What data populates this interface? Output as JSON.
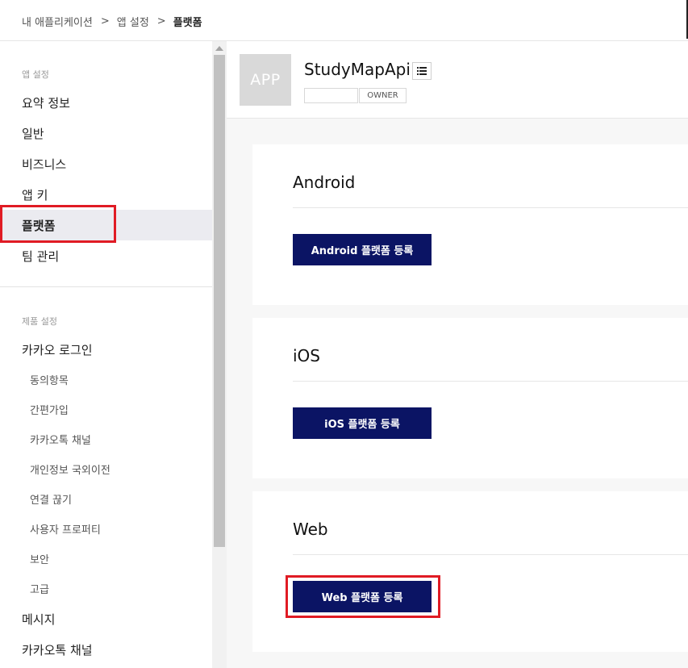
{
  "breadcrumb": {
    "items": [
      "내 애플리케이션",
      "앱 설정",
      "플랫폼"
    ],
    "separator": ">"
  },
  "sidebar": {
    "app_section_title": "앱 설정",
    "app_items": [
      {
        "label": "요약 정보"
      },
      {
        "label": "일반"
      },
      {
        "label": "비즈니스"
      },
      {
        "label": "앱 키"
      },
      {
        "label": "플랫폼",
        "active": true
      },
      {
        "label": "팀 관리"
      }
    ],
    "product_section_title": "제품 설정",
    "kakao_login_label": "카카오 로그인",
    "kakao_login_sub_items": [
      {
        "label": "동의항목"
      },
      {
        "label": "간편가입"
      },
      {
        "label": "카카오톡 채널"
      },
      {
        "label": "개인정보 국외이전"
      },
      {
        "label": "연결 끊기"
      },
      {
        "label": "사용자 프로퍼티"
      },
      {
        "label": "보안"
      },
      {
        "label": "고급"
      }
    ],
    "message_label": "메시지",
    "kakao_channel_label": "카카오톡 채널"
  },
  "app": {
    "logo_text": "APP",
    "name": "StudyMapApi",
    "role_tag": "OWNER",
    "menu_icon": "list-icon"
  },
  "platforms": [
    {
      "title": "Android",
      "button_label": "Android 플랫폼 등록"
    },
    {
      "title": "iOS",
      "button_label": "iOS 플랫폼 등록"
    },
    {
      "title": "Web",
      "button_label": "Web 플랫폼 등록"
    }
  ],
  "colors": {
    "primary_button": "#0b1464",
    "highlight": "#e01b24",
    "active_menu_bg": "#ebebf0"
  }
}
